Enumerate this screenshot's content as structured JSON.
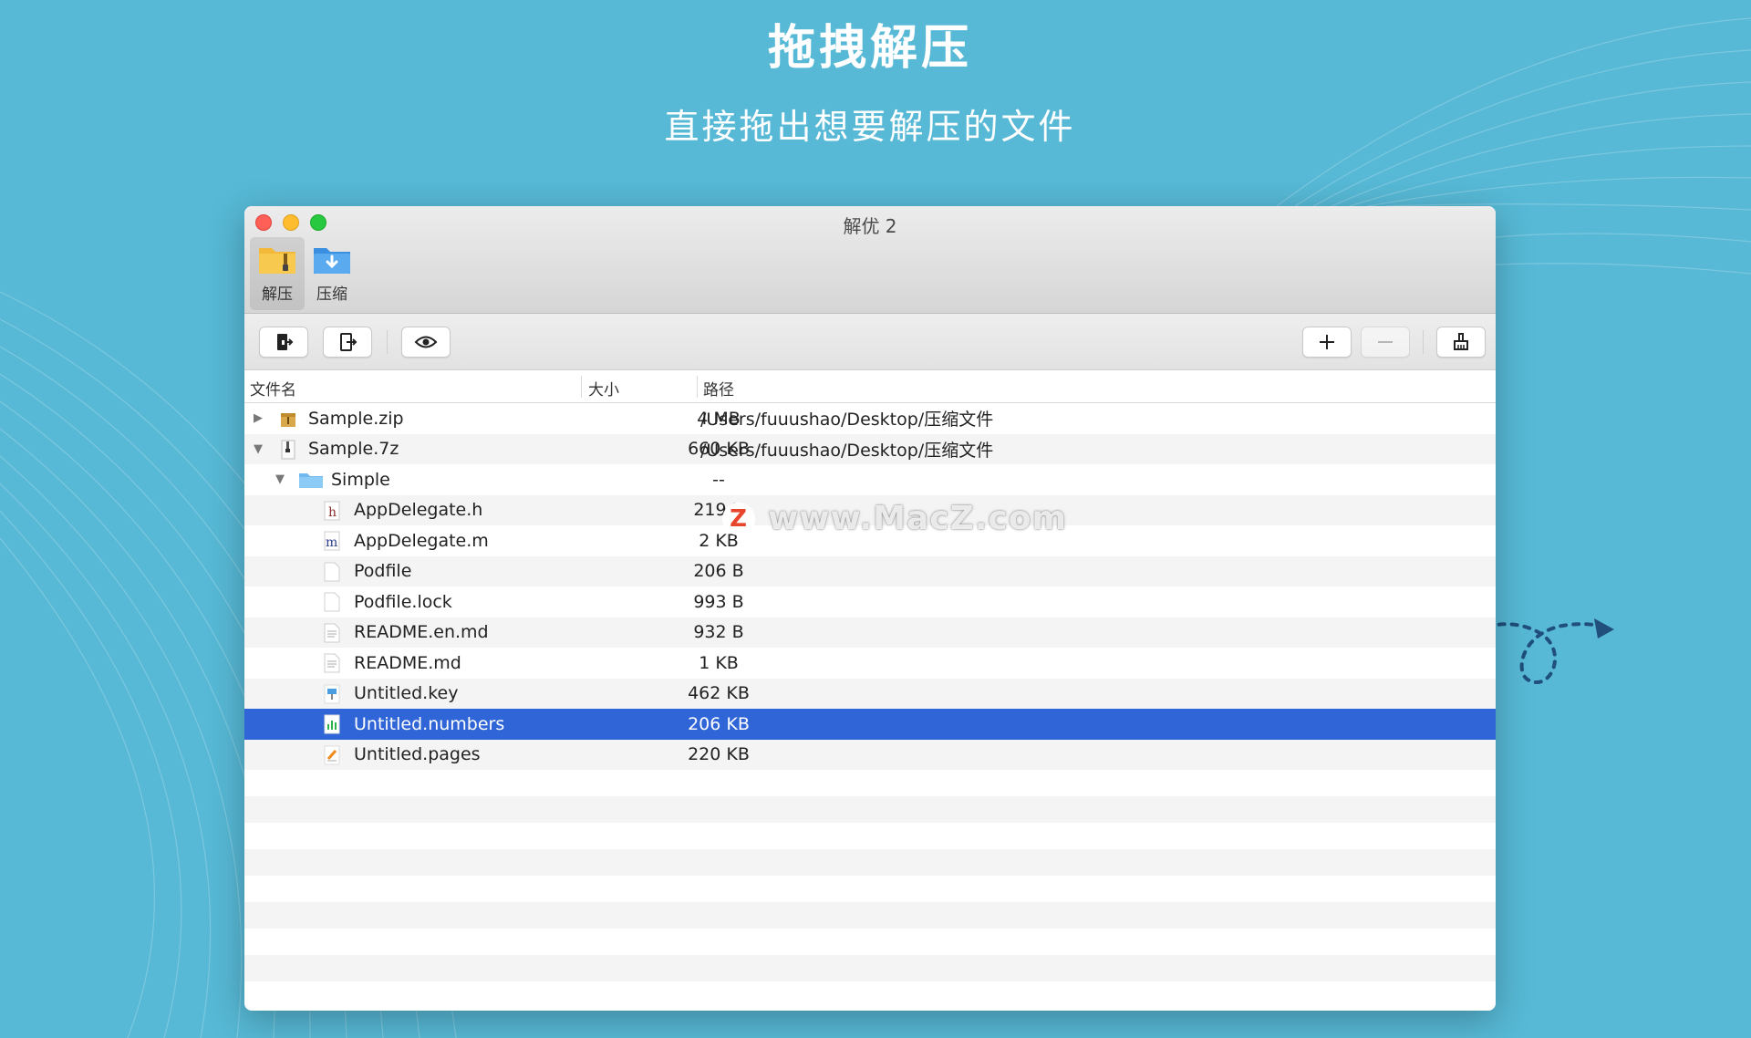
{
  "hero": {
    "title": "拖拽解压",
    "subtitle": "直接拖出想要解压的文件"
  },
  "window": {
    "title": "解优 2",
    "tabs": [
      {
        "label": "解压",
        "icon": "archive-folder-icon",
        "active": true
      },
      {
        "label": "压缩",
        "icon": "compress-folder-icon",
        "active": false
      }
    ]
  },
  "toolbar": {
    "buttons": [
      {
        "icon": "extract-icon"
      },
      {
        "icon": "export-icon"
      },
      {
        "icon": "eye-icon"
      },
      {
        "icon": "plus-icon"
      },
      {
        "icon": "minus-icon"
      },
      {
        "icon": "clean-icon"
      }
    ]
  },
  "table": {
    "columns": {
      "name": "文件名",
      "size": "大小",
      "path": "路径"
    },
    "rows": [
      {
        "name": "Sample.zip",
        "size": "4 MB",
        "path": "/Users/fuuushao/Desktop/压缩文件",
        "icon": "zip-file-icon",
        "disclosure": "▶",
        "indent": 0
      },
      {
        "name": "Sample.7z",
        "size": "660 KB",
        "path": "/Users/fuuushao/Desktop/压缩文件",
        "icon": "7z-file-icon",
        "disclosure": "▼",
        "indent": 0
      },
      {
        "name": "Simple",
        "size": "--",
        "path": "",
        "icon": "folder-icon",
        "disclosure": "▼",
        "indent": 1
      },
      {
        "name": "AppDelegate.h",
        "size": "219 B",
        "path": "",
        "icon": "h-file-icon",
        "disclosure": "",
        "indent": 2
      },
      {
        "name": "AppDelegate.m",
        "size": "2 KB",
        "path": "",
        "icon": "m-file-icon",
        "disclosure": "",
        "indent": 2
      },
      {
        "name": "Podfile",
        "size": "206 B",
        "path": "",
        "icon": "blank-file-icon",
        "disclosure": "",
        "indent": 2
      },
      {
        "name": "Podfile.lock",
        "size": "993 B",
        "path": "",
        "icon": "blank-file-icon",
        "disclosure": "",
        "indent": 2
      },
      {
        "name": "README.en.md",
        "size": "932 B",
        "path": "",
        "icon": "text-file-icon",
        "disclosure": "",
        "indent": 2
      },
      {
        "name": "README.md",
        "size": "1 KB",
        "path": "",
        "icon": "text-file-icon",
        "disclosure": "",
        "indent": 2
      },
      {
        "name": "Untitled.key",
        "size": "462 KB",
        "path": "",
        "icon": "keynote-file-icon",
        "disclosure": "",
        "indent": 2
      },
      {
        "name": "Untitled.numbers",
        "size": "206 KB",
        "path": "",
        "icon": "numbers-file-icon",
        "disclosure": "",
        "indent": 2,
        "selected": true
      },
      {
        "name": "Untitled.pages",
        "size": "220 KB",
        "path": "",
        "icon": "pages-file-icon",
        "disclosure": "",
        "indent": 2
      }
    ]
  },
  "watermark": {
    "logo": "Z",
    "text": "www.MacZ.com"
  },
  "colors": {
    "background": "#57b9d6",
    "selection": "#2f65d6",
    "watermark_logo": "#e8452d"
  }
}
